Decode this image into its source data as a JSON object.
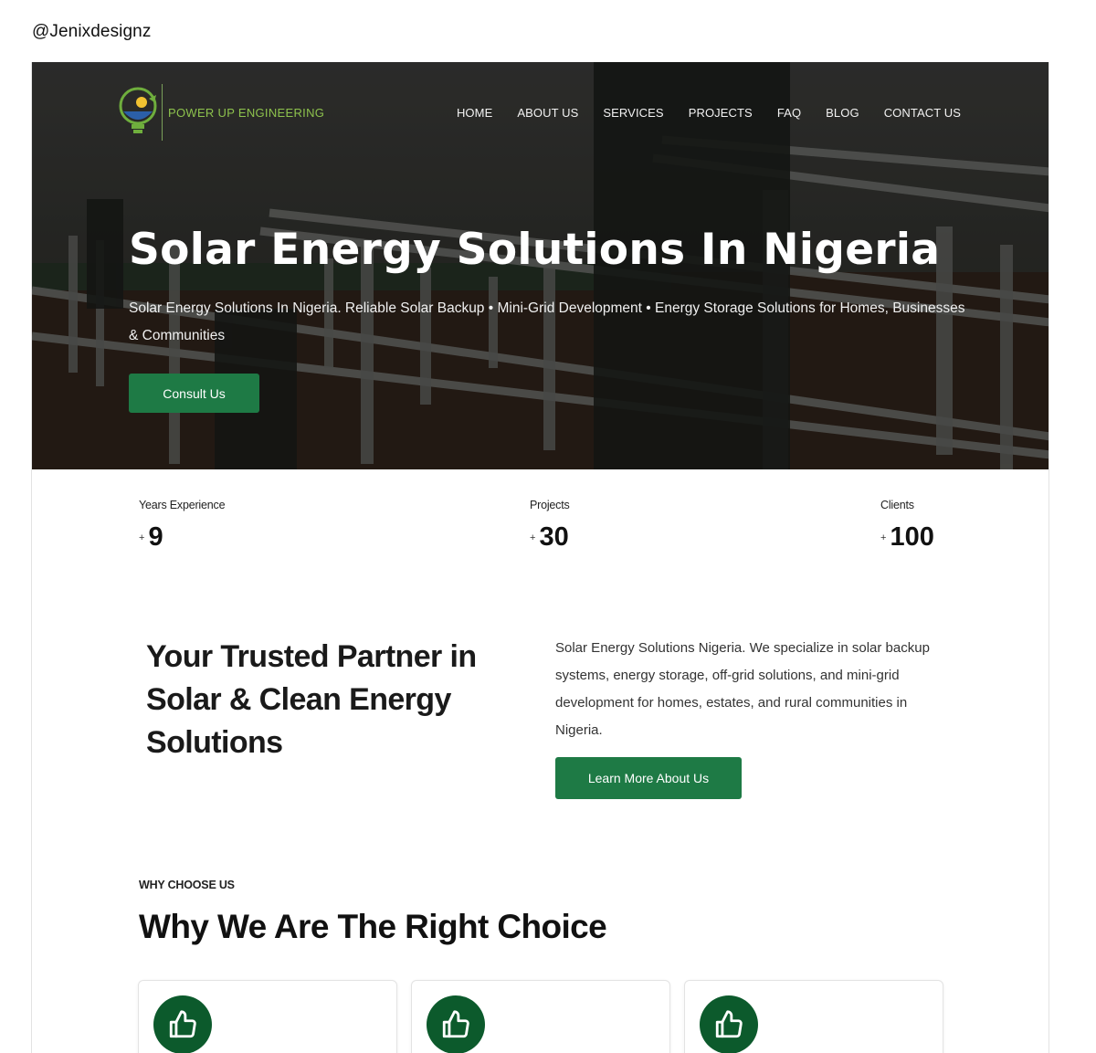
{
  "credit": "@Jenixdesignz",
  "brand": {
    "name": "POWER UP ENGINEERING",
    "logo_icon": "lightbulb-sun-logo",
    "accent": "#1e7a45",
    "logo_green": "#8dc24d"
  },
  "nav": [
    "HOME",
    "ABOUT US",
    "SERVICES",
    "PROJECTS",
    "FAQ",
    "BLOG",
    "CONTACT US"
  ],
  "hero": {
    "title": "Solar Energy Solutions In Nigeria",
    "subtitle": "Solar Energy Solutions In Nigeria. Reliable Solar Backup • Mini-Grid Development • Energy Storage Solutions for Homes, Businesses & Communities",
    "cta": "Consult Us"
  },
  "stats": [
    {
      "label": "Years Experience",
      "plus": "+",
      "value": "9"
    },
    {
      "label": "Projects",
      "plus": "+",
      "value": "30"
    },
    {
      "label": "Clients",
      "plus": "+",
      "value": "100"
    }
  ],
  "about": {
    "title": "Your Trusted Partner in Solar & Clean Energy Solutions",
    "text": "Solar Energy Solutions Nigeria. We specialize in solar backup systems, energy storage, off-grid solutions, and mini-grid development for homes, estates, and rural communities in Nigeria.",
    "cta": "Learn More About Us"
  },
  "why": {
    "tag": "WHY CHOOSE US",
    "title": "Why We Are The Right Choice",
    "card_icon": "thumbs-up-icon",
    "card_icon_bg": "#0c5a2c"
  }
}
